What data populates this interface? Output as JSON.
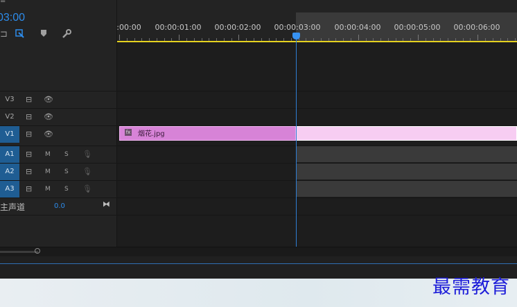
{
  "window": {
    "menu_glyph": "≡"
  },
  "timeline": {
    "timecode": "03:00",
    "tools": [
      "snap-icon",
      "linked-selection-icon",
      "add-marker-icon",
      "settings-wrench-icon"
    ],
    "tool_glyphs": [
      "⊐",
      "⬚",
      "⬟",
      "🔧"
    ],
    "ruler_labels": [
      ":00:00",
      "00:00:01:00",
      "00:00:02:00",
      "00:00:03:00",
      "00:00:04:00",
      "00:00:05:00",
      "00:00:06:00"
    ],
    "playhead_timecode": "00:00:03:00",
    "colors": {
      "accent": "#2d8ceb",
      "work_area": "#e5d21f",
      "video_clip": "#d783d7",
      "clip_selected": "#f7cdf2"
    }
  },
  "tracks": {
    "video": [
      {
        "name": "V3",
        "targeted": false
      },
      {
        "name": "V2",
        "targeted": false
      },
      {
        "name": "V1",
        "targeted": true
      }
    ],
    "audio": [
      {
        "name": "A1",
        "mute": "M",
        "solo": "S"
      },
      {
        "name": "A2",
        "mute": "M",
        "solo": "S"
      },
      {
        "name": "A3",
        "mute": "M",
        "solo": "S"
      }
    ],
    "master": {
      "label": "主声道",
      "value": "0.0"
    }
  },
  "clips": {
    "v1_clip_name": "烟花.jpg"
  },
  "watermark": "最需教育"
}
